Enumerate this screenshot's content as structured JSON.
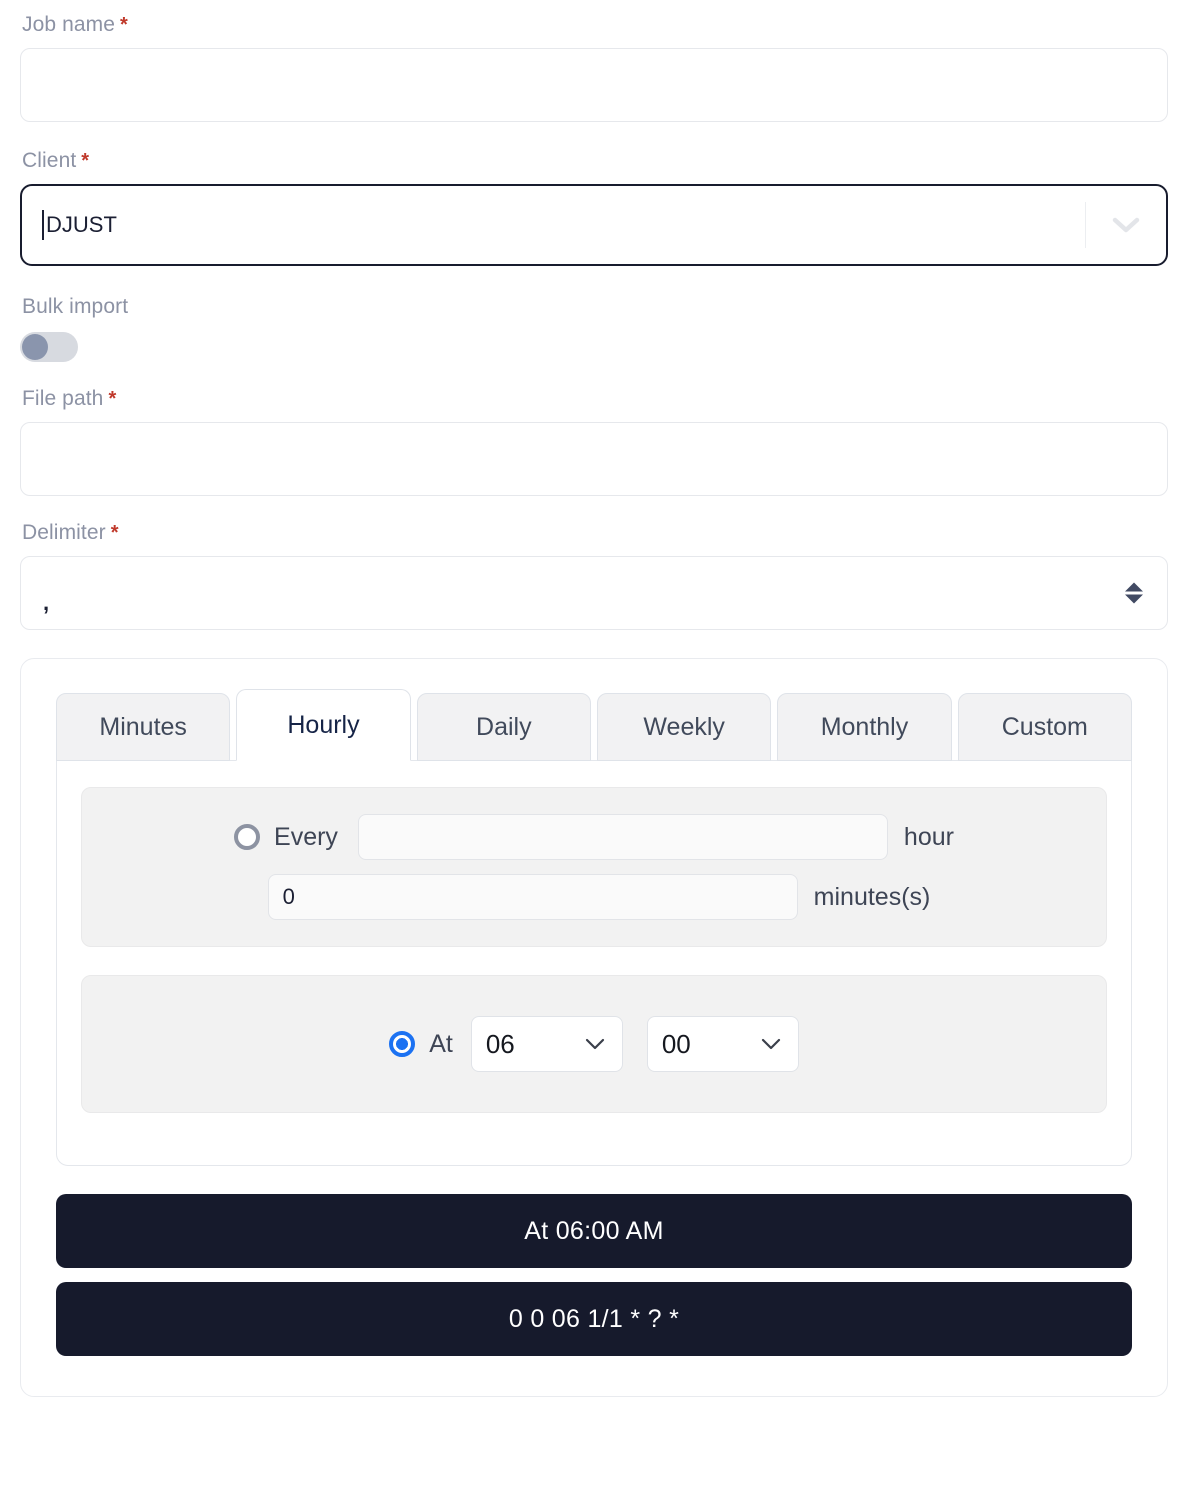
{
  "form": {
    "job_name": {
      "label": "Job name",
      "required_mark": "*",
      "value": "",
      "placeholder": ""
    },
    "client": {
      "label": "Client",
      "required_mark": "*",
      "value": "DJUST",
      "dropdown_icon": "chevron-down-icon"
    },
    "bulk_import": {
      "label": "Bulk import",
      "state": "off"
    },
    "file_path": {
      "label": "File path",
      "required_mark": "*",
      "value": "",
      "placeholder": ""
    },
    "delimiter": {
      "label": "Delimiter",
      "required_mark": "*",
      "value": ",",
      "spinner_icon": "updown-arrows-icon"
    }
  },
  "scheduler": {
    "tabs": [
      {
        "label": "Minutes",
        "active": false
      },
      {
        "label": "Hourly",
        "active": true
      },
      {
        "label": "Daily",
        "active": false
      },
      {
        "label": "Weekly",
        "active": false
      },
      {
        "label": "Monthly",
        "active": false
      },
      {
        "label": "Custom",
        "active": false
      }
    ],
    "every_option": {
      "radio_label": "Every",
      "selected": false,
      "hour_value": "",
      "hour_unit": "hour",
      "minutes_value": "0",
      "minutes_unit": "minutes(s)"
    },
    "at_option": {
      "radio_label": "At",
      "selected": true,
      "hour_value": "06",
      "minute_value": "00",
      "hour_icon": "chevron-down-icon",
      "minute_icon": "chevron-down-icon"
    },
    "summary_human": "At 06:00 AM",
    "summary_cron": "0 0 06 1/1 * ? *"
  },
  "colors": {
    "label": "#8c92a4",
    "required": "#c0392b",
    "accent_radio": "#1c72f2",
    "summary_bg": "#161a2c",
    "tab_inactive_bg": "#f2f2f3",
    "active_tab_text": "#162447"
  }
}
